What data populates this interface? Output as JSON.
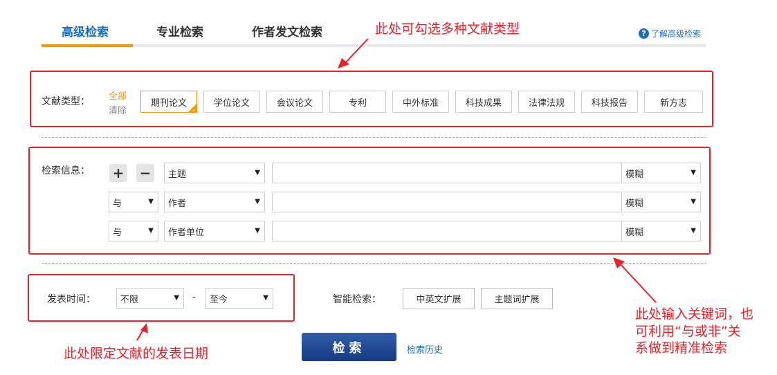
{
  "tabs": [
    {
      "label": "高级检索",
      "active": true
    },
    {
      "label": "专业检索",
      "active": false
    },
    {
      "label": "作者发文检索",
      "active": false
    }
  ],
  "help": {
    "icon": "question-icon",
    "label": "了解高级检索"
  },
  "doc_types": {
    "label": "文献类型：",
    "select_all": "全部",
    "clear": "清除",
    "items": [
      {
        "label": "期刊论文",
        "checked": true
      },
      {
        "label": "学位论文",
        "checked": false
      },
      {
        "label": "会议论文",
        "checked": false
      },
      {
        "label": "专利",
        "checked": false
      },
      {
        "label": "中外标准",
        "checked": false
      },
      {
        "label": "科技成果",
        "checked": false
      },
      {
        "label": "法律法规",
        "checked": false
      },
      {
        "label": "科技报告",
        "checked": false
      },
      {
        "label": "新方志",
        "checked": false
      }
    ]
  },
  "search_info": {
    "label": "检索信息：",
    "add_symbol": "+",
    "remove_symbol": "−",
    "rows": [
      {
        "logic": "",
        "field": "主题",
        "value": "",
        "match": "模糊"
      },
      {
        "logic": "与",
        "field": "作者",
        "value": "",
        "match": "模糊"
      },
      {
        "logic": "与",
        "field": "作者单位",
        "value": "",
        "match": "模糊"
      }
    ]
  },
  "publish_time": {
    "label": "发表时间：",
    "from": "不限",
    "separator": "-",
    "to": "至今"
  },
  "smart_search": {
    "label": "智能检索：",
    "options": [
      "中英文扩展",
      "主题词扩展"
    ]
  },
  "search_button": "检索",
  "history_link": "检索历史",
  "annotations": {
    "doc_types": "此处可勾选多种文献类型",
    "keywords": [
      "此处输入关键词，也",
      "可利用“与或非”关",
      "系做到精准检索"
    ],
    "date": "此处限定文献的发表日期"
  },
  "colors": {
    "accent": "#f39800",
    "link": "#1a6fc0",
    "annotation": "#e8212a",
    "button": "#1f4a93"
  }
}
